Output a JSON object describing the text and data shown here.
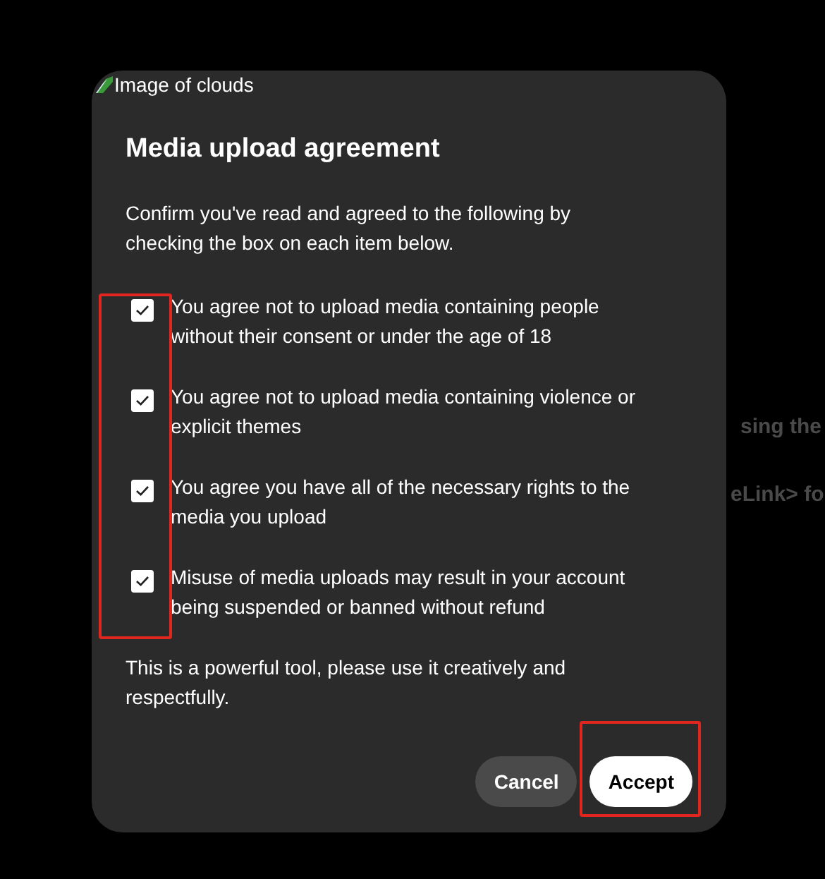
{
  "background_texts": [
    "sing the",
    "eLink> fo"
  ],
  "dialog": {
    "broken_image_alt": "Image of clouds",
    "title": "Media upload agreement",
    "intro": "Confirm you've read and agreed to the following by checking the box on each item below.",
    "items": [
      {
        "label": "You agree not to upload media containing people without their consent or under the age of 18",
        "checked": true
      },
      {
        "label": "You agree not to upload media containing violence or explicit themes",
        "checked": true
      },
      {
        "label": "You agree you have all of the necessary rights to the media you upload",
        "checked": true
      },
      {
        "label": "Misuse of media uploads may result in your account being suspended or banned without refund",
        "checked": true
      }
    ],
    "note": "This is a powerful tool, please use it creatively and respectfully.",
    "buttons": [
      {
        "label": "Cancel",
        "kind": "secondary"
      },
      {
        "label": "Accept",
        "kind": "primary"
      }
    ]
  }
}
